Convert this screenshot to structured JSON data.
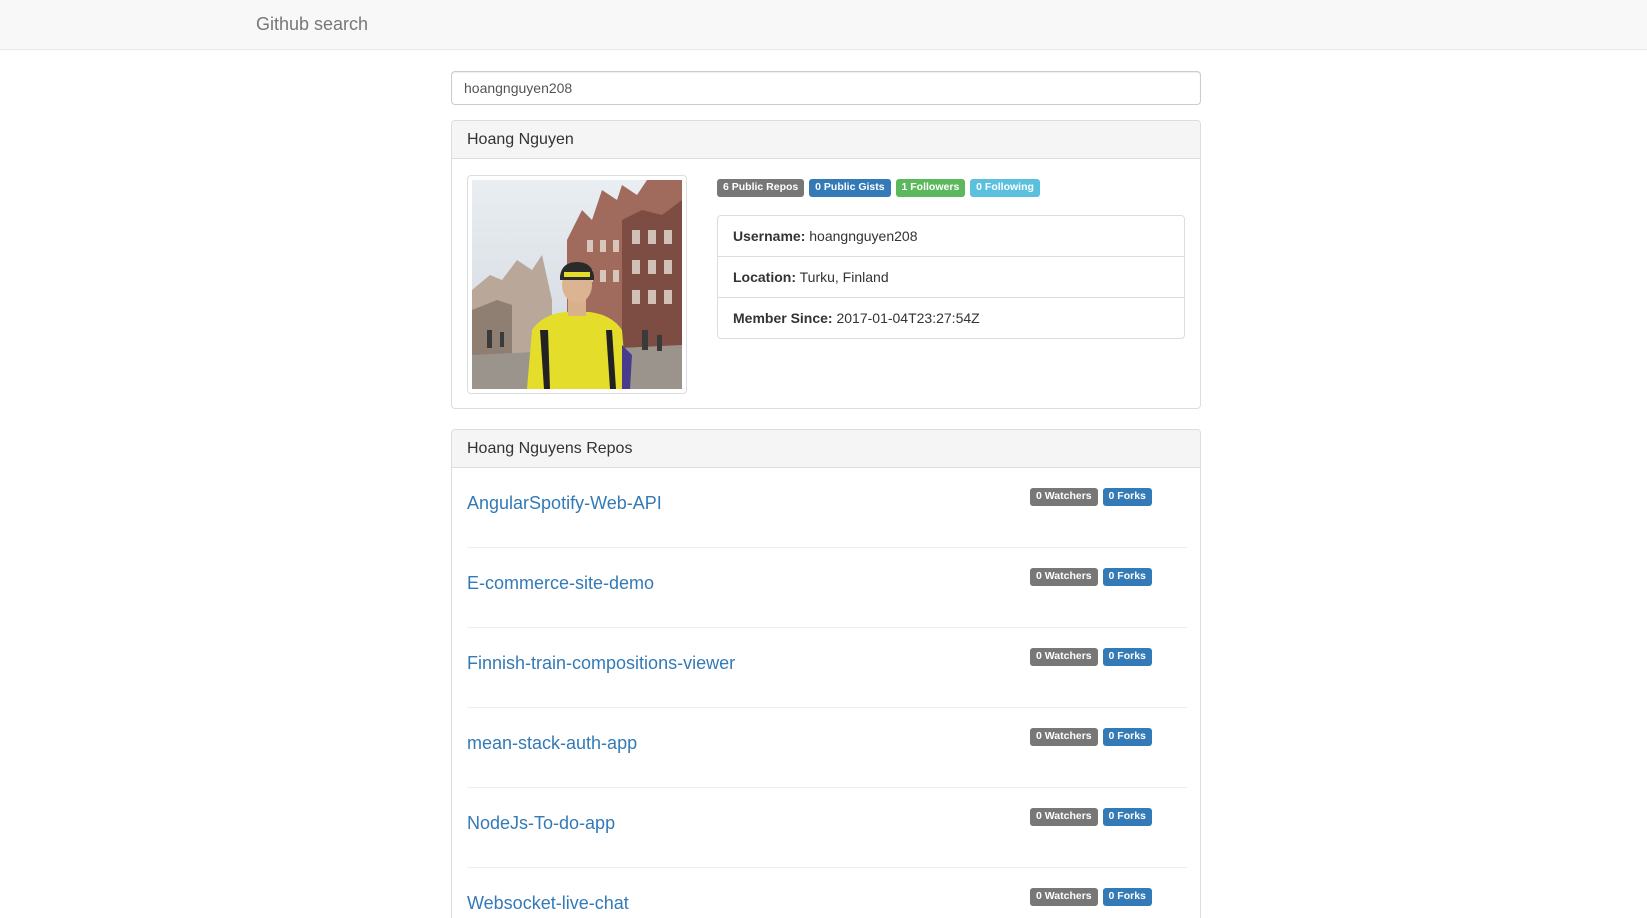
{
  "navbar": {
    "brand": "Github search"
  },
  "search": {
    "value": "hoangnguyen208"
  },
  "profile": {
    "name": "Hoang Nguyen",
    "badges": {
      "public_repos": "6 Public Repos",
      "public_gists": "0 Public Gists",
      "followers": "1 Followers",
      "following": "0 Following"
    },
    "details": {
      "username_label": "Username:",
      "username": "hoangnguyen208",
      "location_label": "Location:",
      "location": "Turku, Finland",
      "member_since_label": "Member Since:",
      "member_since": "2017-01-04T23:27:54Z"
    }
  },
  "repos": {
    "heading": "Hoang Nguyens Repos",
    "items": [
      {
        "name": "AngularSpotify-Web-API",
        "watchers": "0 Watchers",
        "forks": "0 Forks"
      },
      {
        "name": "E-commerce-site-demo",
        "watchers": "0 Watchers",
        "forks": "0 Forks"
      },
      {
        "name": "Finnish-train-compositions-viewer",
        "watchers": "0 Watchers",
        "forks": "0 Forks"
      },
      {
        "name": "mean-stack-auth-app",
        "watchers": "0 Watchers",
        "forks": "0 Forks"
      },
      {
        "name": "NodeJs-To-do-app",
        "watchers": "0 Watchers",
        "forks": "0 Forks"
      },
      {
        "name": "Websocket-live-chat",
        "watchers": "0 Watchers",
        "forks": "0 Forks"
      }
    ]
  },
  "colors": {
    "link": "#337ab7",
    "label_default": "#777777",
    "label_primary": "#337ab7",
    "label_success": "#5cb85c",
    "label_info": "#5bc0de"
  }
}
